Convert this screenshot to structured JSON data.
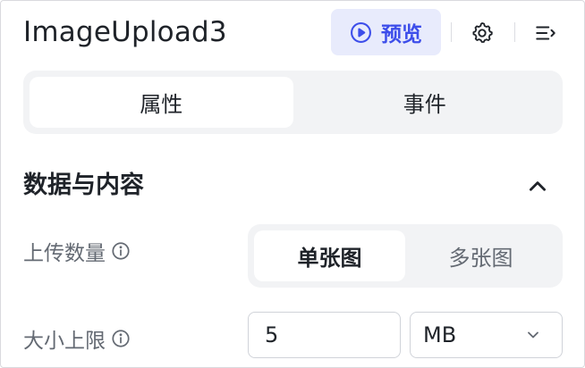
{
  "header": {
    "title": "ImageUpload3",
    "preview_label": "预览",
    "preview_icon": "play-circle-icon",
    "settings_icon": "gear-icon",
    "collapse_panel_icon": "collapse-right-icon"
  },
  "tabs": [
    {
      "label": "属性",
      "active": true
    },
    {
      "label": "事件",
      "active": false
    }
  ],
  "section": {
    "title": "数据与内容",
    "expanded": true
  },
  "fields": {
    "upload_count": {
      "label": "上传数量",
      "options": [
        {
          "label": "单张图",
          "selected": true
        },
        {
          "label": "多张图",
          "selected": false
        }
      ]
    },
    "size_limit": {
      "label": "大小上限",
      "value": "5",
      "unit": "MB"
    }
  },
  "colors": {
    "accent": "#3d4eea",
    "accent_bg": "#e8ebfc",
    "segment_bg": "#f2f3f5",
    "label_text": "#646a73"
  }
}
